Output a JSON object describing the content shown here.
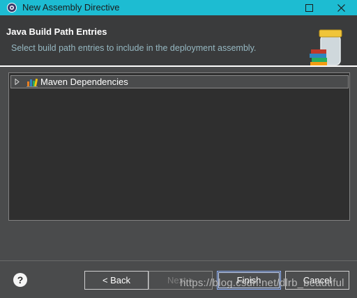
{
  "window": {
    "title": "New Assembly Directive",
    "controls": {
      "maximize_icon": "maximize-icon",
      "close_icon": "close-icon"
    }
  },
  "header": {
    "title": "Java Build Path Entries",
    "description": "Select build path entries to include in the deployment assembly.",
    "icon": "library-jar-icon"
  },
  "tree": {
    "items": [
      {
        "label": "Maven Dependencies",
        "expanded": false,
        "icon": "library-icon"
      }
    ]
  },
  "footer": {
    "help_symbol": "?",
    "buttons": {
      "back": "< Back",
      "next": "Next >",
      "finish": "Finish",
      "cancel": "Cancel"
    },
    "next_enabled": false
  },
  "watermark": "https://blog.csdn.net/dlrb_beautiful",
  "colors": {
    "titlebar": "#1dbcd2",
    "header_bg": "#3a3b3c",
    "body_bg": "#4a4b4c",
    "tree_bg": "#2f2f2f",
    "description_text": "#96b8c2"
  }
}
